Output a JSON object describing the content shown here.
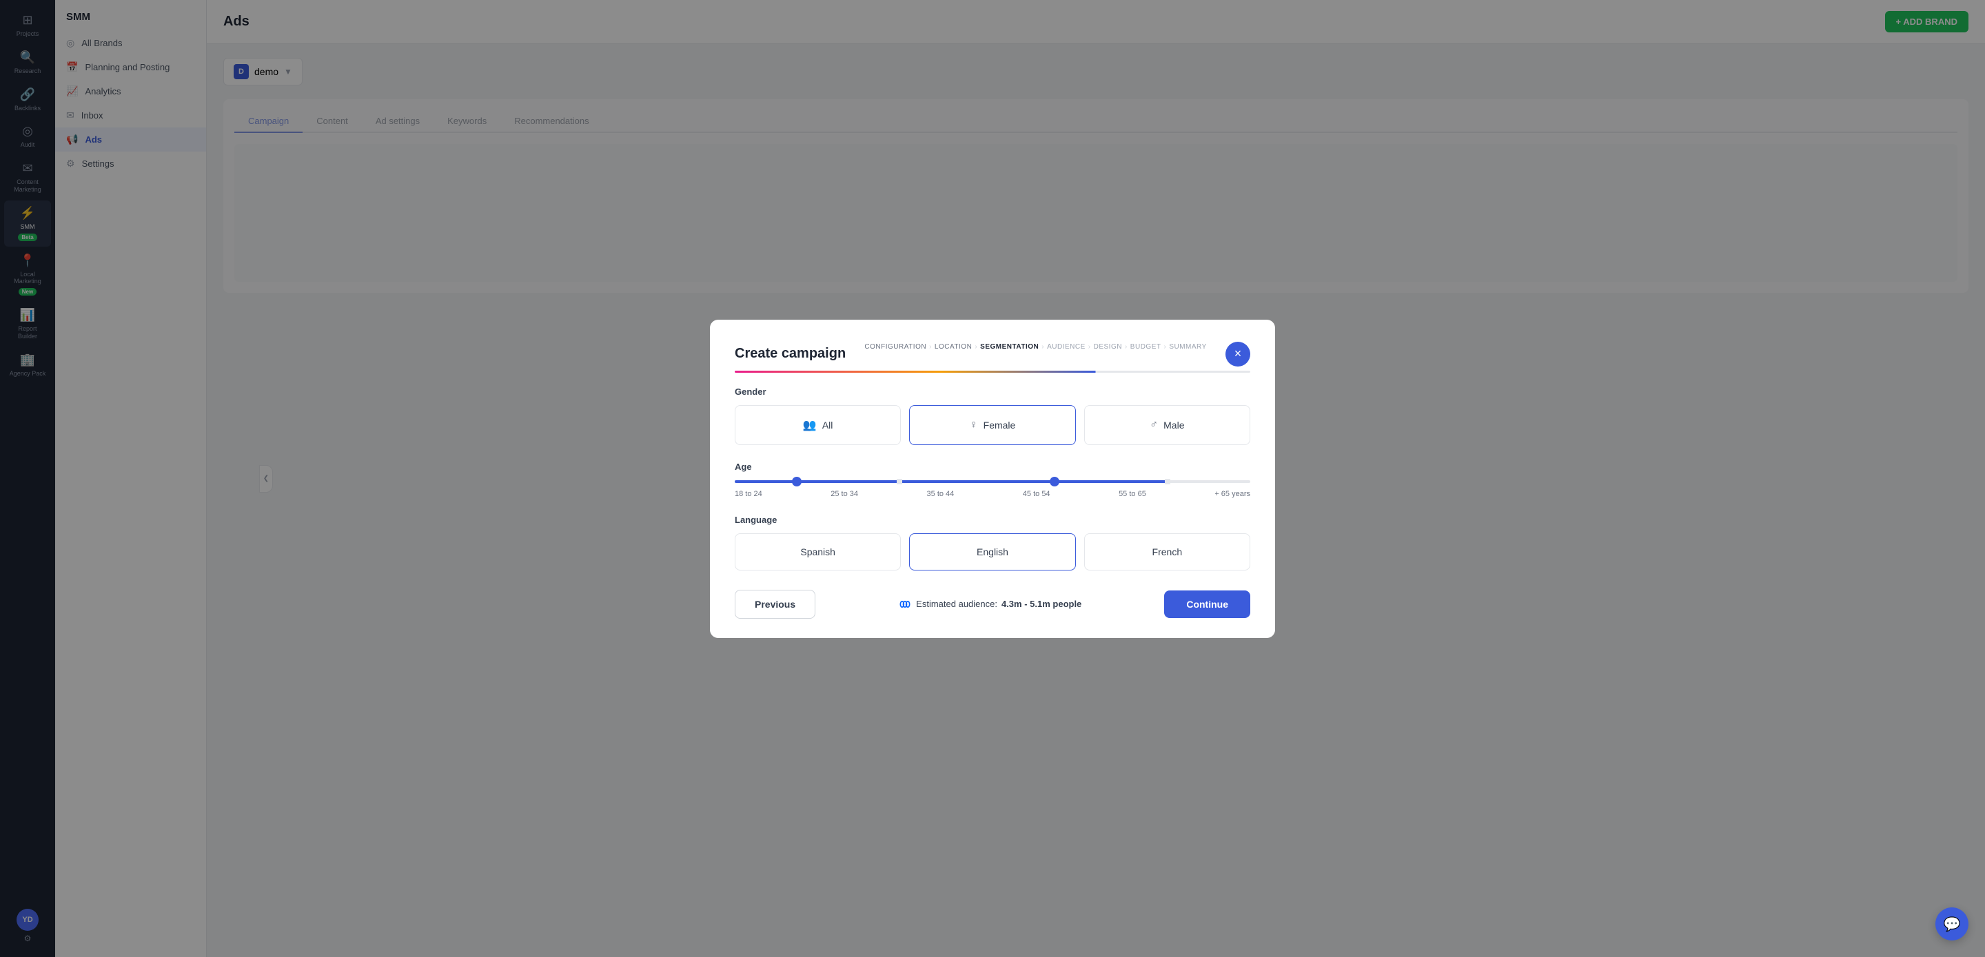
{
  "app": {
    "title": "SMM"
  },
  "sidebar": {
    "items": [
      {
        "id": "projects",
        "label": "Projects",
        "icon": "⊞"
      },
      {
        "id": "research",
        "label": "Research",
        "icon": "🔍"
      },
      {
        "id": "backlinks",
        "label": "Backlinks",
        "icon": "🔗"
      },
      {
        "id": "audit",
        "label": "Audit",
        "icon": "◎"
      },
      {
        "id": "content-marketing",
        "label": "Content Marketing",
        "icon": "✉"
      },
      {
        "id": "smm",
        "label": "SMM",
        "icon": "⚡",
        "badge": "Beta",
        "active": true
      },
      {
        "id": "local-marketing",
        "label": "Local Marketing",
        "icon": "📍",
        "badge": "New"
      },
      {
        "id": "report-builder",
        "label": "Report Builder",
        "icon": "📊"
      },
      {
        "id": "agency-pack",
        "label": "Agency Pack",
        "icon": "🏢"
      }
    ],
    "avatar": "YD",
    "settings_icon": "⚙"
  },
  "nav_panel": {
    "title": "SMM",
    "items": [
      {
        "id": "all-brands",
        "label": "All Brands",
        "icon": "◎"
      },
      {
        "id": "planning-posting",
        "label": "Planning and Posting",
        "icon": "📅"
      },
      {
        "id": "analytics",
        "label": "Analytics",
        "icon": "📈"
      },
      {
        "id": "inbox",
        "label": "Inbox",
        "icon": "✉"
      },
      {
        "id": "ads",
        "label": "Ads",
        "icon": "📢",
        "active": true
      },
      {
        "id": "settings",
        "label": "Settings",
        "icon": "⚙"
      }
    ]
  },
  "main": {
    "page_title": "Ads",
    "add_brand_label": "+ ADD BRAND",
    "brand_selector": {
      "initial": "D",
      "name": "demo"
    }
  },
  "bg_tabs": [
    "Campaign",
    "Content",
    "Ad settings",
    "Keywords",
    "Recommendations"
  ],
  "modal": {
    "title": "Create campaign",
    "close_label": "×",
    "wizard_steps": [
      {
        "id": "configuration",
        "label": "CONFIGURATION",
        "state": "done"
      },
      {
        "id": "location",
        "label": "LOCATION",
        "state": "done"
      },
      {
        "id": "segmentation",
        "label": "SEGMENTATION",
        "state": "active"
      },
      {
        "id": "audience",
        "label": "AUDIENCE",
        "state": "inactive"
      },
      {
        "id": "design",
        "label": "DESIGN",
        "state": "inactive"
      },
      {
        "id": "budget",
        "label": "BUDGET",
        "state": "inactive"
      },
      {
        "id": "summary",
        "label": "SUMMARY",
        "state": "inactive"
      }
    ],
    "gender_label": "Gender",
    "gender_options": [
      {
        "id": "all",
        "label": "All",
        "icon": "👥",
        "selected": false
      },
      {
        "id": "female",
        "label": "Female",
        "icon": "♀",
        "selected": true
      },
      {
        "id": "male",
        "label": "Male",
        "icon": "♂",
        "selected": false
      }
    ],
    "age_label": "Age",
    "age_labels": [
      "18 to 24",
      "25 to 34",
      "35 to 44",
      "45 to 54",
      "55 to 65",
      "+ 65 years"
    ],
    "age_slider": {
      "left_percent": 12,
      "right_percent": 70
    },
    "language_label": "Language",
    "language_options": [
      {
        "id": "spanish",
        "label": "Spanish",
        "selected": false
      },
      {
        "id": "english",
        "label": "English",
        "selected": true
      },
      {
        "id": "french",
        "label": "French",
        "selected": false
      }
    ],
    "prev_label": "Previous",
    "audience_est_label": "Estimated audience:",
    "audience_est_value": "4.3m - 5.1m people",
    "continue_label": "Continue"
  }
}
